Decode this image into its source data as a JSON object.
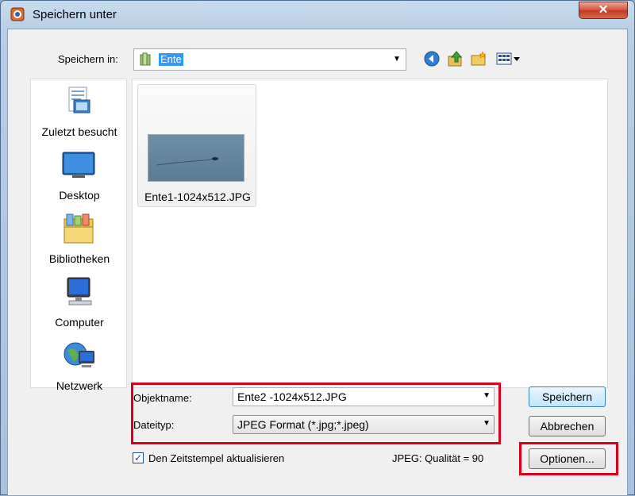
{
  "window": {
    "title": "Speichern unter",
    "close_label": "✕"
  },
  "toolbar": {
    "save_in_label": "Speichern in:",
    "location": "Ente",
    "icons": [
      "back-icon",
      "up-folder-icon",
      "new-folder-icon",
      "view-menu-icon"
    ]
  },
  "places": [
    {
      "label": "Zuletzt besucht",
      "icon": "recent-places-icon"
    },
    {
      "label": "Desktop",
      "icon": "desktop-icon"
    },
    {
      "label": "Bibliotheken",
      "icon": "libraries-icon"
    },
    {
      "label": "Computer",
      "icon": "computer-icon"
    },
    {
      "label": "Netzwerk",
      "icon": "network-icon"
    }
  ],
  "files": [
    {
      "name": "Ente1-1024x512.JPG"
    }
  ],
  "form": {
    "name_label": "Objektname:",
    "name_value": "Ente2 -1024x512.JPG",
    "type_label": "Dateityp:",
    "type_value": "JPEG Format (*.jpg;*.jpeg)",
    "timestamp_label": "Den Zeitstempel aktualisieren",
    "timestamp_checked": true,
    "quality_text": "JPEG: Qualität = 90"
  },
  "buttons": {
    "save": "Speichern",
    "cancel": "Abbrechen",
    "options": "Optionen..."
  },
  "colors": {
    "highlight": "#d9001b",
    "selection": "#3399ff"
  }
}
